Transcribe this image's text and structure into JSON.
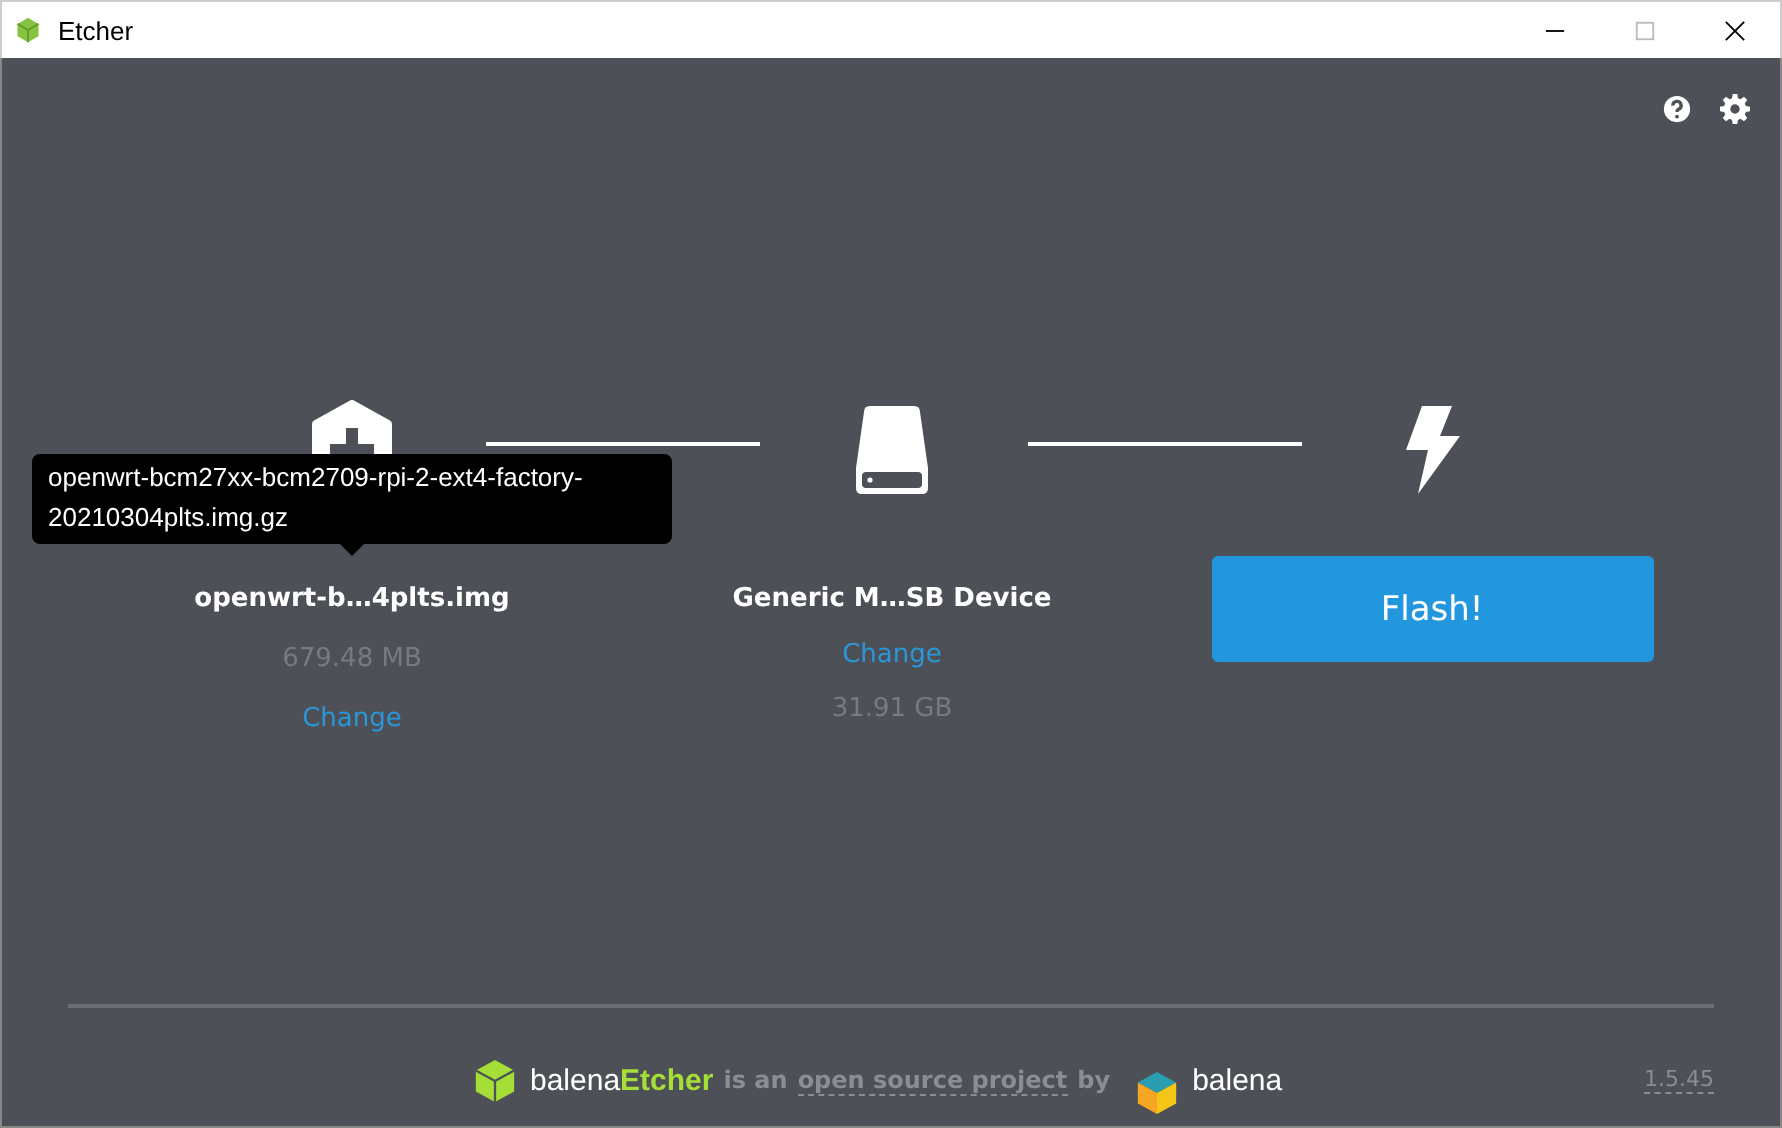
{
  "window": {
    "title": "Etcher"
  },
  "steps": [
    {
      "kind": "image",
      "name": "openwrt-b…4plts.img",
      "size": "679.48 MB",
      "change": "Change",
      "tooltip": "openwrt-bcm27xx-bcm2709-rpi-2-ext4-factory-20210304plts.img.gz"
    },
    {
      "kind": "drive",
      "name": "Generic M…SB Device",
      "change": "Change",
      "size": "31.91 GB"
    },
    {
      "kind": "flash",
      "button": "Flash!"
    }
  ],
  "footer": {
    "brand": "balena",
    "brand_accent": "Etcher",
    "tagline_before": "is an",
    "tagline_link": "open source project",
    "tagline_after": "by",
    "company": "balena",
    "version": "1.5.45"
  }
}
